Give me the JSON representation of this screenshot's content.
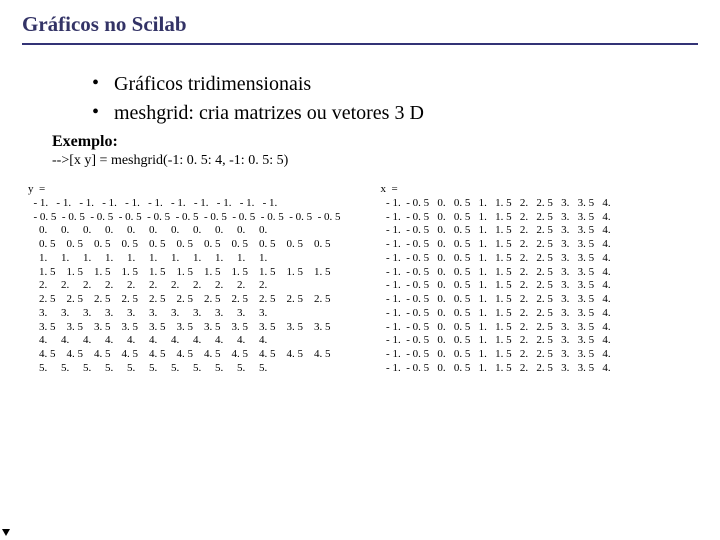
{
  "title": "Gráficos no Scilab",
  "bullets": {
    "b1": "Gráficos tridimensionais",
    "b2": "meshgrid: cria matrizes ou vetores 3 D"
  },
  "example": {
    "label": "Exemplo:",
    "command": "-->[x y] = meshgrid(-1: 0. 5: 4, -1: 0. 5: 5)"
  },
  "y": {
    "label": "y  =",
    "rows": "  - 1.   - 1.   - 1.   - 1.   - 1.   - 1.   - 1.   - 1.   - 1.   - 1.   - 1.\n  - 0. 5  - 0. 5  - 0. 5  - 0. 5  - 0. 5  - 0. 5  - 0. 5  - 0. 5  - 0. 5  - 0. 5  - 0. 5\n    0.     0.     0.     0.     0.     0.     0.     0.     0.     0.     0.\n    0. 5    0. 5    0. 5    0. 5    0. 5    0. 5    0. 5    0. 5    0. 5    0. 5    0. 5\n    1.     1.     1.     1.     1.     1.     1.     1.     1.     1.     1.\n    1. 5    1. 5    1. 5    1. 5    1. 5    1. 5    1. 5    1. 5    1. 5    1. 5    1. 5\n    2.     2.     2.     2.     2.     2.     2.     2.     2.     2.     2.\n    2. 5    2. 5    2. 5    2. 5    2. 5    2. 5    2. 5    2. 5    2. 5    2. 5    2. 5\n    3.     3.     3.     3.     3.     3.     3.     3.     3.     3.     3.\n    3. 5    3. 5    3. 5    3. 5    3. 5    3. 5    3. 5    3. 5    3. 5    3. 5    3. 5\n    4.     4.     4.     4.     4.     4.     4.     4.     4.     4.     4.\n    4. 5    4. 5    4. 5    4. 5    4. 5    4. 5    4. 5    4. 5    4. 5    4. 5    4. 5\n    5.     5.     5.     5.     5.     5.     5.     5.     5.     5.     5."
  },
  "x": {
    "label": "x  =",
    "rows": "  - 1.  - 0. 5   0.   0. 5   1.   1. 5   2.   2. 5   3.   3. 5   4.\n  - 1.  - 0. 5   0.   0. 5   1.   1. 5   2.   2. 5   3.   3. 5   4.\n  - 1.  - 0. 5   0.   0. 5   1.   1. 5   2.   2. 5   3.   3. 5   4.\n  - 1.  - 0. 5   0.   0. 5   1.   1. 5   2.   2. 5   3.   3. 5   4.\n  - 1.  - 0. 5   0.   0. 5   1.   1. 5   2.   2. 5   3.   3. 5   4.\n  - 1.  - 0. 5   0.   0. 5   1.   1. 5   2.   2. 5   3.   3. 5   4.\n  - 1.  - 0. 5   0.   0. 5   1.   1. 5   2.   2. 5   3.   3. 5   4.\n  - 1.  - 0. 5   0.   0. 5   1.   1. 5   2.   2. 5   3.   3. 5   4.\n  - 1.  - 0. 5   0.   0. 5   1.   1. 5   2.   2. 5   3.   3. 5   4.\n  - 1.  - 0. 5   0.   0. 5   1.   1. 5   2.   2. 5   3.   3. 5   4.\n  - 1.  - 0. 5   0.   0. 5   1.   1. 5   2.   2. 5   3.   3. 5   4.\n  - 1.  - 0. 5   0.   0. 5   1.   1. 5   2.   2. 5   3.   3. 5   4.\n  - 1.  - 0. 5   0.   0. 5   1.   1. 5   2.   2. 5   3.   3. 5   4."
  }
}
